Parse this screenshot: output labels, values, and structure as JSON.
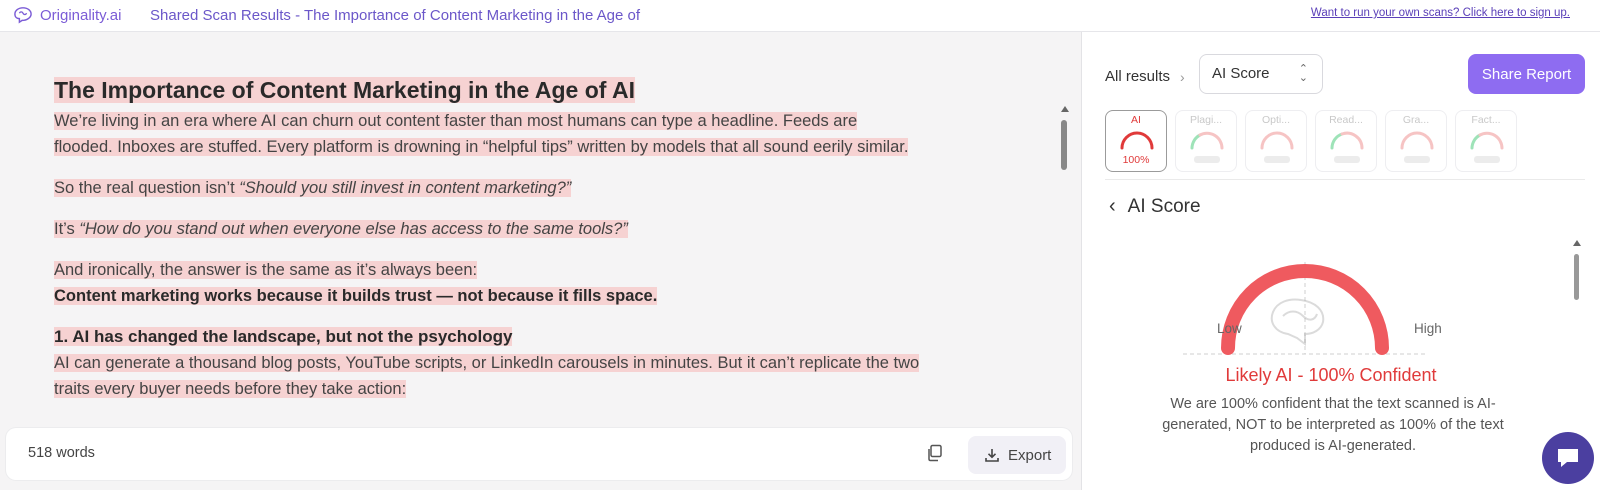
{
  "header": {
    "logo_text": "Originality.ai",
    "title": "Shared Scan Results - The Importance of Content Marketing in the Age of",
    "signup_link": "Want to run your own scans? Click here to sign up."
  },
  "document": {
    "heading": "The Importance of Content Marketing in the Age of AI",
    "para1_line1": "We’re living in an era where AI can churn out content faster than most humans can type a headline. Feeds are",
    "para1_line2": "flooded. Inboxes are stuffed. Every platform is drowning in “helpful tips” written by models that all sound eerily similar.",
    "para2_prefix": "So the real question isn’t ",
    "para2_italic": "“Should you still invest in content marketing?”",
    "para3_prefix": "It’s ",
    "para3_italic": "“How do you stand out when everyone else has access to the same tools?”",
    "para4_line1": "And ironically, the answer is the same as it’s always been:",
    "para4_line2": "Content marketing works because it builds trust — not because it fills space.",
    "section_heading": "1. AI has changed the landscape, but not the psychology",
    "para5_line1": "AI can generate a thousand blog posts, YouTube scripts, or LinkedIn carousels in minutes. But it can’t replicate the two",
    "para5_line2": "traits every buyer needs before they take action:"
  },
  "footer": {
    "word_count": "518 words",
    "export_label": "Export"
  },
  "sidebar": {
    "breadcrumb": "All results",
    "select_value": "AI Score",
    "share_label": "Share Report",
    "tabs": [
      {
        "label": "AI",
        "value": "100%",
        "active": true
      },
      {
        "label": "Plagi...",
        "value": ""
      },
      {
        "label": "Opti...",
        "value": ""
      },
      {
        "label": "Read...",
        "value": ""
      },
      {
        "label": "Gra...",
        "value": ""
      },
      {
        "label": "Fact...",
        "value": ""
      }
    ],
    "section_title": "AI Score",
    "gauge": {
      "low_label": "Low",
      "high_label": "High",
      "score_percent": 100
    },
    "verdict": "Likely AI - 100% Confident",
    "explanation": "We are 100% confident that the text scanned is AI-generated, NOT to be interpreted as 100% of the text produced is AI-generated."
  },
  "colors": {
    "accent": "#8e6cf1",
    "ai_red": "#e03a3a",
    "highlight": "#f6d2d2",
    "gauge_red": "#ef5a5f"
  }
}
